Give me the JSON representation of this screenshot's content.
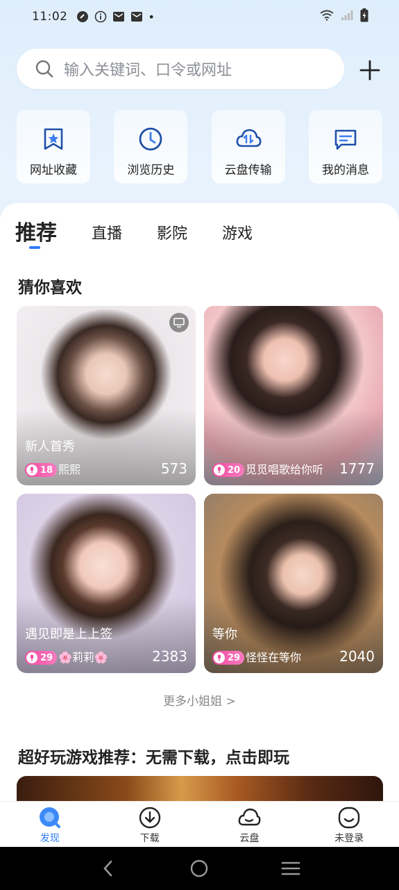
{
  "status_bar": {
    "time": "11:02",
    "dot": "•"
  },
  "search": {
    "placeholder": "输入关键词、口令或网址"
  },
  "quick_tiles": [
    {
      "label": "网址收藏",
      "icon": "bookmark-star-icon"
    },
    {
      "label": "浏览历史",
      "icon": "clock-icon"
    },
    {
      "label": "云盘传输",
      "icon": "cloud-transfer-icon"
    },
    {
      "label": "我的消息",
      "icon": "message-icon"
    }
  ],
  "tabs": [
    {
      "label": "推荐",
      "active": true
    },
    {
      "label": "直播",
      "active": false
    },
    {
      "label": "影院",
      "active": false
    },
    {
      "label": "游戏",
      "active": false
    }
  ],
  "section_guess": {
    "title": "猜你喜欢"
  },
  "cards": [
    {
      "subtitle": "新人首秀",
      "level": "18",
      "name": "熙熙",
      "count": "573",
      "has_tv_icon": true
    },
    {
      "subtitle": "",
      "level": "20",
      "name": "觅觅唱歌给你听",
      "count": "1777",
      "has_tv_icon": false
    },
    {
      "subtitle": "遇见即是上上签",
      "level": "29",
      "name": "🌸莉莉🌸",
      "count": "2383",
      "has_tv_icon": false
    },
    {
      "subtitle": "等你",
      "level": "29",
      "name": "怪怪在等你",
      "count": "2040",
      "has_tv_icon": false
    }
  ],
  "more_link": "更多小姐姐 >",
  "section_games": {
    "title": "超好玩游戏推荐：无需下载，点击即玩"
  },
  "bottom_nav": [
    {
      "label": "发现",
      "icon": "discover-icon",
      "active": true
    },
    {
      "label": "下载",
      "icon": "download-icon",
      "active": false
    },
    {
      "label": "云盘",
      "icon": "cloud-icon",
      "active": false
    },
    {
      "label": "未登录",
      "icon": "profile-icon",
      "active": false
    }
  ],
  "colors": {
    "accent": "#2f7df6",
    "badge": "#f4489f"
  }
}
